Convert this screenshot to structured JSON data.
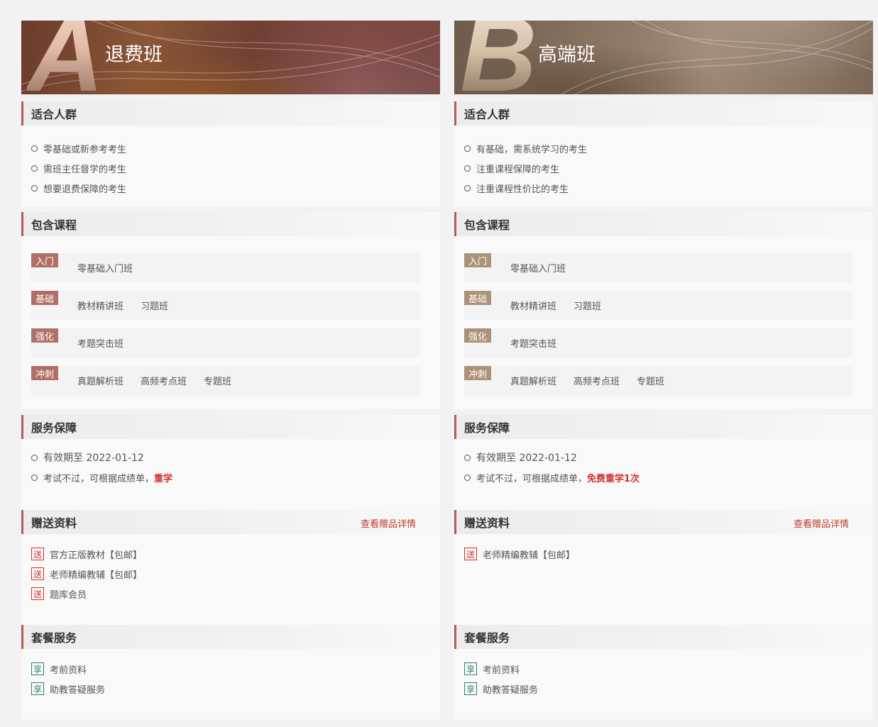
{
  "columns": [
    {
      "letter": "A",
      "title": "退费班",
      "audience_head": "适合人群",
      "audience": [
        "零基础或新参考考生",
        "需班主任督学的考生",
        "想要退费保障的考生"
      ],
      "courses_head": "包含课程",
      "courses": [
        {
          "tag": "入门",
          "items": [
            "零基础入门班"
          ]
        },
        {
          "tag": "基础",
          "items": [
            "教材精讲班",
            "习题班"
          ]
        },
        {
          "tag": "强化",
          "items": [
            "考题突击班"
          ]
        },
        {
          "tag": "冲刺",
          "items": [
            "真题解析班",
            "高频考点班",
            "专题班"
          ]
        }
      ],
      "service_head": "服务保障",
      "validity": "有效期至 2022-01-12",
      "fail_text": "考试不过，可根据成绩单，",
      "fail_highlight": "重学",
      "gift_head": "赠送资料",
      "gift_link": "查看赠品详情",
      "gift_icon": "送",
      "gifts": [
        "官方正版教材【包邮】",
        "老师精编教辅【包邮】",
        "题库会员"
      ],
      "package_head": "套餐服务",
      "package_icon": "享",
      "packages": [
        "考前资料",
        "助教答疑服务"
      ]
    },
    {
      "letter": "B",
      "title": "高端班",
      "audience_head": "适合人群",
      "audience": [
        "有基础，需系统学习的考生",
        "注重课程保障的考生",
        "注重课程性价比的考生"
      ],
      "courses_head": "包含课程",
      "courses": [
        {
          "tag": "入门",
          "items": [
            "零基础入门班"
          ]
        },
        {
          "tag": "基础",
          "items": [
            "教材精讲班",
            "习题班"
          ]
        },
        {
          "tag": "强化",
          "items": [
            "考题突击班"
          ]
        },
        {
          "tag": "冲刺",
          "items": [
            "真题解析班",
            "高频考点班",
            "专题班"
          ]
        }
      ],
      "service_head": "服务保障",
      "validity": "有效期至 2022-01-12",
      "fail_text": "考试不过，可根据成绩单，",
      "fail_highlight": "免费重学1次",
      "gift_head": "赠送资料",
      "gift_link": "查看赠品详情",
      "gift_icon": "送",
      "gifts": [
        "老师精编教辅【包邮】"
      ],
      "package_head": "套餐服务",
      "package_icon": "享",
      "packages": [
        "考前资料",
        "助教答疑服务"
      ]
    }
  ],
  "colors": {
    "accent_red": "#d0312d",
    "tag_a": "#b06e66",
    "tag_b": "#ab9279",
    "service_icon": "#2f7e78"
  }
}
